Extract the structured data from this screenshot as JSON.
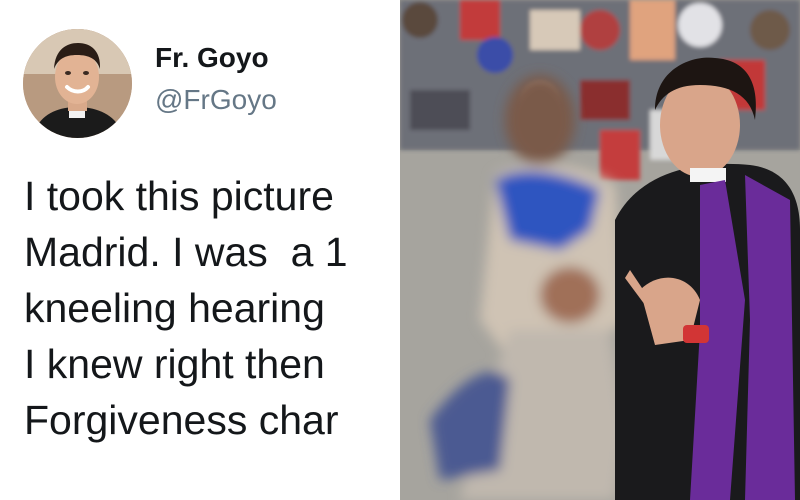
{
  "tweet": {
    "author_name": "Fr. Goyo",
    "author_handle": "@FrGoyo",
    "lines": [
      "I took this picture",
      "Madrid. I was  a 1",
      "kneeling hearing",
      "I knew right then",
      "Forgiveness char"
    ]
  },
  "icons": {
    "avatar": "profile-avatar-priest",
    "photo": "confession-photo"
  },
  "colors": {
    "text": "#14171a",
    "handle": "#657786",
    "stole": "#6a2c9a",
    "background": "#ffffff"
  }
}
